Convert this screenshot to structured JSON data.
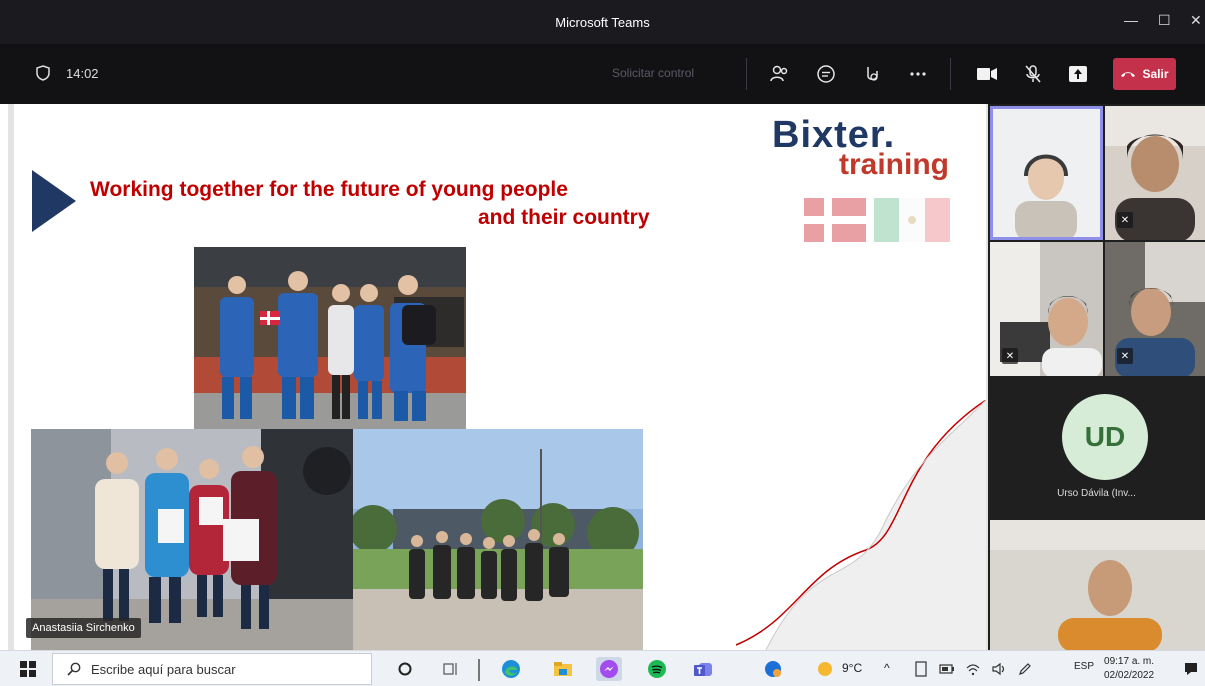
{
  "window": {
    "title": "Microsoft Teams",
    "controls": {
      "minimize": "—",
      "maximize": "☐",
      "close": "✕"
    }
  },
  "meeting": {
    "elapsed": "14:02",
    "request_control": "Solicitar control",
    "leave_label": "Salir",
    "toolbar_icons": [
      "people-icon",
      "chat-icon",
      "reactions-icon",
      "more-icon",
      "camera-icon",
      "mic-off-icon",
      "share-icon"
    ]
  },
  "slide": {
    "brand_line1": "Bixter.",
    "brand_line2": "training",
    "headline_line1": "Working together for the future of young people",
    "headline_line2": "and their country",
    "presenter_name": "Anastasiia Sirchenko",
    "colors": {
      "headline": "#c00000",
      "navy": "#1f3864",
      "brand_red": "#c0392b"
    }
  },
  "participants": {
    "avatar_initials": "UD",
    "avatar_name": "Urso Dávila (Inv..."
  },
  "taskbar": {
    "search_placeholder": "Escribe aquí para buscar",
    "weather": "9°C",
    "language": "ESP",
    "time": "09:17 a. m.",
    "date": "02/02/2022"
  }
}
